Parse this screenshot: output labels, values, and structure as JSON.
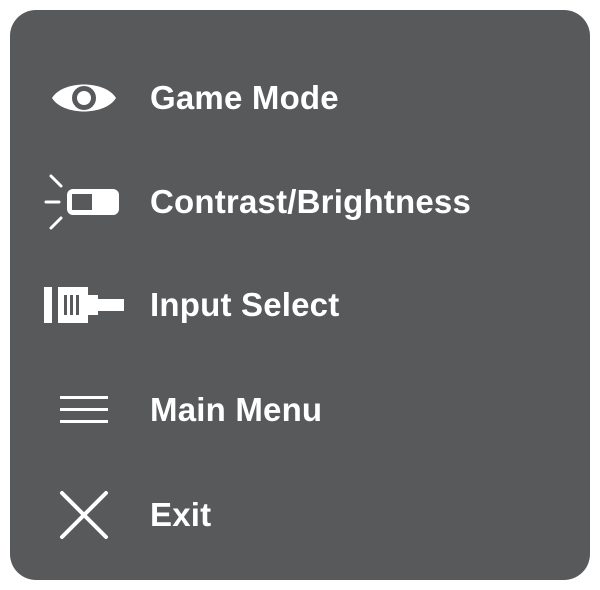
{
  "menu": {
    "items": [
      {
        "label": "Game Mode",
        "icon": "eye-icon"
      },
      {
        "label": "Contrast/Brightness",
        "icon": "contrast-brightness-icon"
      },
      {
        "label": "Input Select",
        "icon": "input-connector-icon"
      },
      {
        "label": "Main Menu",
        "icon": "hamburger-menu-icon"
      },
      {
        "label": "Exit",
        "icon": "close-x-icon"
      }
    ]
  },
  "colors": {
    "panel_background": "#58595b",
    "text": "#ffffff",
    "page_background": "#ffffff"
  }
}
